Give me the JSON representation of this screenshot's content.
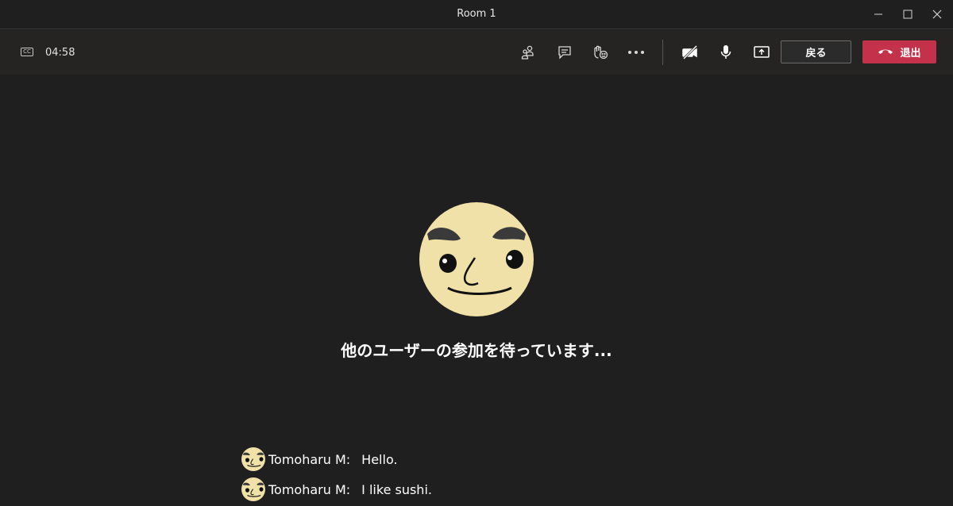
{
  "window": {
    "title": "Room 1",
    "controls": [
      "minimize-icon",
      "maximize-icon",
      "close-icon"
    ]
  },
  "toolbar": {
    "captions_icon": "closed-captions-icon",
    "captions_glyph": "CC",
    "timer": "04:58",
    "icons": [
      "participants-icon",
      "chat-icon",
      "reactions-icon",
      "more-options-icon",
      "camera-off-icon",
      "microphone-icon",
      "share-screen-icon"
    ],
    "back_label": "戻る",
    "leave_label": "退出",
    "leave_color": "#c4314b"
  },
  "stage": {
    "avatar": "cartoon-face-avatar",
    "waiting_text": "他のユーザーの参加を待っています..."
  },
  "chat": {
    "messages": [
      {
        "sender": "Tomoharu M:",
        "text": "Hello."
      },
      {
        "sender": "Tomoharu M:",
        "text": "I like sushi."
      }
    ]
  },
  "colors": {
    "background": "#1f1f1f",
    "toolbar": "#252423",
    "avatar_skin": "#f0e1a8"
  }
}
